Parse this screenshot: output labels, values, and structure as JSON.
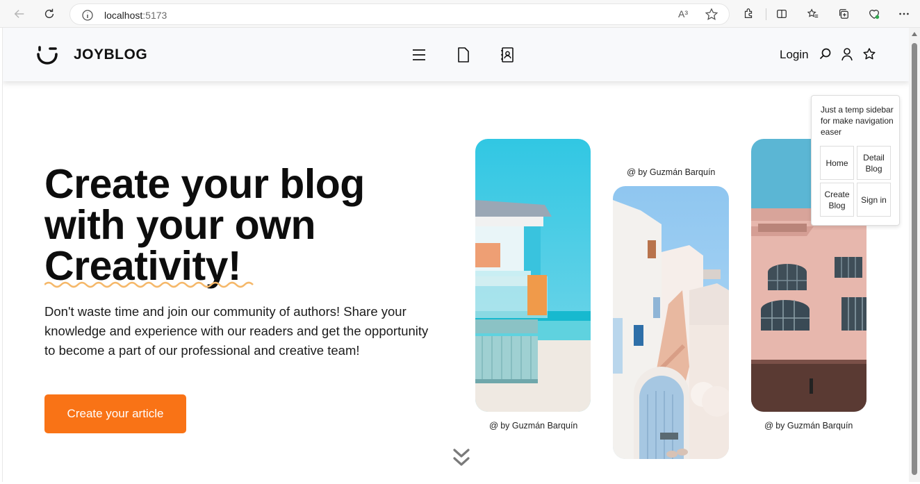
{
  "browser": {
    "url_host": "localhost",
    "url_port": ":5173",
    "read_aloud": "A³"
  },
  "header": {
    "brand": "JOYBLOG",
    "login_label": "Login"
  },
  "hero": {
    "title_line1": "Create your blog",
    "title_line2": "with your own",
    "title_line3": "Creativity!",
    "description": "Don't waste time and join our community of authors! Share your knowledge and experience with our readers and get the opportunity to become a part of our professional and creative team!",
    "cta_label": "Create your article"
  },
  "gallery": {
    "credit_symbol": "@",
    "credits": [
      "by Guzmán Barquín",
      "by Guzmán Barquín",
      "by Guzmán Barquín"
    ]
  },
  "temp_sidebar": {
    "note": "Just a temp sidebar for make navigation easer",
    "buttons": [
      "Home",
      "Detail Blog",
      "Create Blog",
      "Sign in"
    ]
  },
  "colors": {
    "accent": "#f97316",
    "squiggle": "#f5b86a"
  }
}
